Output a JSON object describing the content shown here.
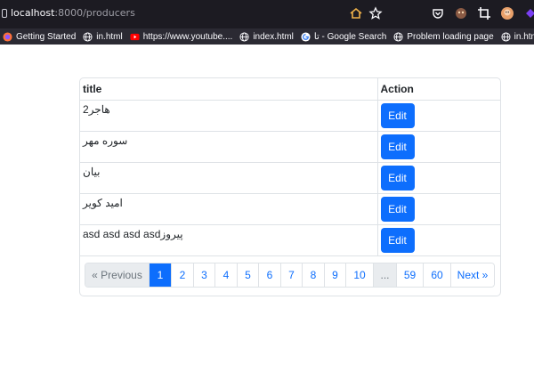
{
  "browser": {
    "url_host": "localhost",
    "url_rest": ":8000/producers",
    "bookmarks": [
      {
        "label": "Getting Started",
        "icon": "firefox-icon"
      },
      {
        "label": "in.html",
        "icon": "globe-icon"
      },
      {
        "label": "https://www.youtube....",
        "icon": "youtube-icon"
      },
      {
        "label": "index.html",
        "icon": "globe-icon"
      },
      {
        "label": "تا - Google Search",
        "icon": "google-icon"
      },
      {
        "label": "Problem loading page",
        "icon": "globe-icon"
      },
      {
        "label": "in.html",
        "icon": "globe-icon"
      }
    ]
  },
  "table": {
    "headers": {
      "title": "title",
      "action": "Action"
    },
    "rows": [
      {
        "title": "هاجر2",
        "action": "Edit"
      },
      {
        "title": "سوره مهر",
        "action": "Edit"
      },
      {
        "title": "بیان",
        "action": "Edit"
      },
      {
        "title": "امید کویر",
        "action": "Edit"
      },
      {
        "title": "asd asd asd asdپیروز",
        "action": "Edit"
      }
    ]
  },
  "pagination": {
    "previous": "« Previous",
    "pages": [
      "1",
      "2",
      "3",
      "4",
      "5",
      "6",
      "7",
      "8",
      "9",
      "10"
    ],
    "ellipsis": "...",
    "tail_pages": [
      "59",
      "60"
    ],
    "next": "Next »",
    "active_page": "1"
  },
  "colors": {
    "primary": "#0d6efd",
    "border": "#dee2e6",
    "browser_toolbar": "#1c1b22",
    "bookmarks_bar": "#2b2a33"
  }
}
